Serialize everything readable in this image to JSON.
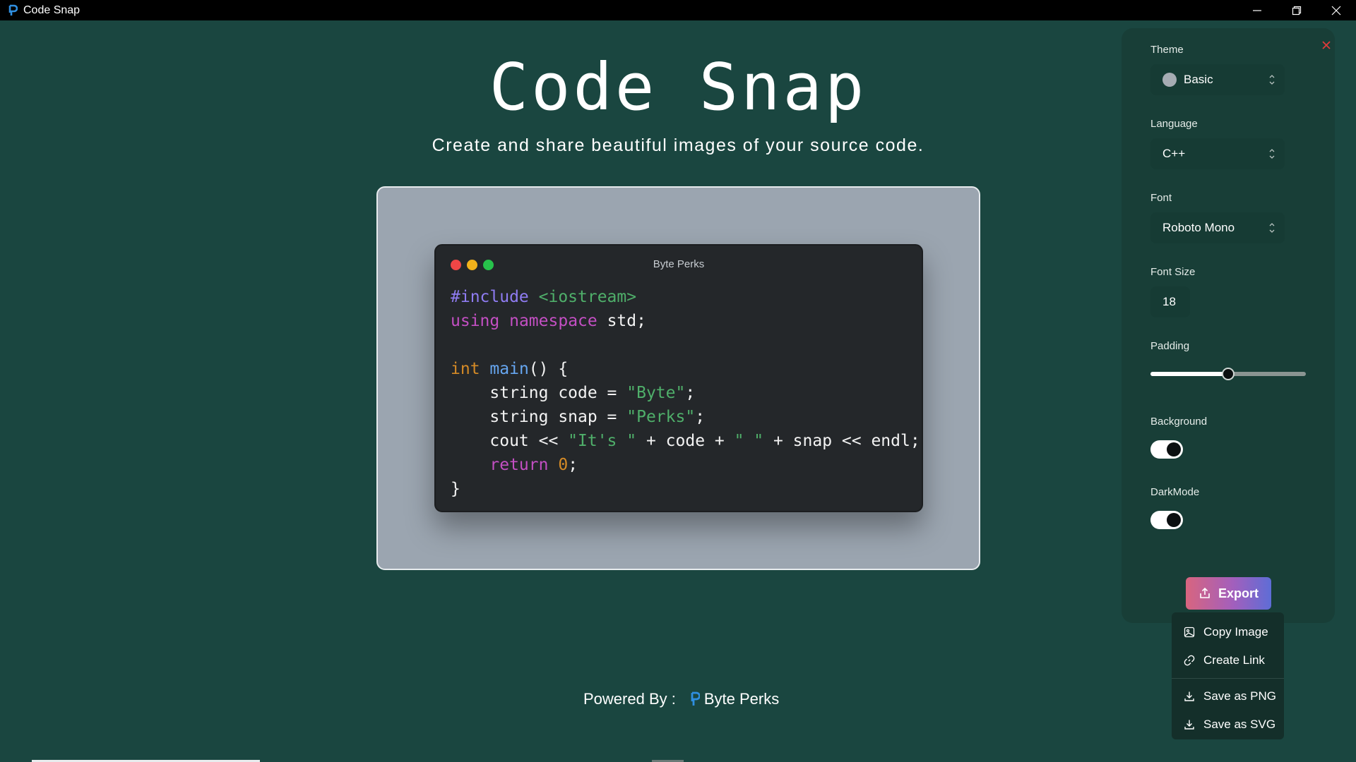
{
  "window": {
    "title": "Code Snap",
    "controls": [
      "minimize-icon",
      "restore-icon",
      "close-icon"
    ]
  },
  "header": {
    "title": "Code Snap",
    "subtitle": "Create and share beautiful images of your source code."
  },
  "code_window": {
    "title": "Byte Perks",
    "dots": [
      "#f04646",
      "#f2b21b",
      "#27c24b"
    ],
    "lines": [
      [
        {
          "t": "#include",
          "c": "pre"
        },
        {
          "t": " <iostream>",
          "c": "inc"
        }
      ],
      [
        {
          "t": "using",
          "c": "kw"
        },
        {
          "t": " ",
          "c": ""
        },
        {
          "t": "namespace",
          "c": "kw"
        },
        {
          "t": " std;",
          "c": ""
        }
      ],
      [
        {
          "t": "",
          "c": ""
        }
      ],
      [
        {
          "t": "int",
          "c": "type"
        },
        {
          "t": " ",
          "c": ""
        },
        {
          "t": "main",
          "c": "fn"
        },
        {
          "t": "() {",
          "c": ""
        }
      ],
      [
        {
          "t": "    string code = ",
          "c": ""
        },
        {
          "t": "\"Byte\"",
          "c": "str"
        },
        {
          "t": ";",
          "c": ""
        }
      ],
      [
        {
          "t": "    string snap = ",
          "c": ""
        },
        {
          "t": "\"Perks\"",
          "c": "str"
        },
        {
          "t": ";",
          "c": ""
        }
      ],
      [
        {
          "t": "    cout << ",
          "c": ""
        },
        {
          "t": "\"It's \"",
          "c": "str"
        },
        {
          "t": " + code + ",
          "c": ""
        },
        {
          "t": "\" \"",
          "c": "str"
        },
        {
          "t": " + snap << endl;",
          "c": ""
        }
      ],
      [
        {
          "t": "    ",
          "c": ""
        },
        {
          "t": "return",
          "c": "kw"
        },
        {
          "t": " ",
          "c": ""
        },
        {
          "t": "0",
          "c": "num"
        },
        {
          "t": ";",
          "c": ""
        }
      ],
      [
        {
          "t": "}",
          "c": ""
        }
      ]
    ]
  },
  "footer": {
    "label": "Powered By :",
    "brand": "Byte Perks"
  },
  "panel": {
    "theme": {
      "label": "Theme",
      "value": "Basic",
      "swatch": "#a6acb3"
    },
    "language": {
      "label": "Language",
      "value": "C++"
    },
    "font": {
      "label": "Font",
      "value": "Roboto Mono"
    },
    "font_size": {
      "label": "Font Size",
      "value": "18"
    },
    "padding": {
      "label": "Padding",
      "fraction": 0.5
    },
    "background": {
      "label": "Background",
      "on": true
    },
    "dark_mode": {
      "label": "DarkMode",
      "on": true
    },
    "export_label": "Export"
  },
  "export_menu": {
    "copy_image": "Copy Image",
    "create_link": "Create Link",
    "save_png": "Save as PNG",
    "save_svg": "Save as SVG"
  },
  "colors": {
    "background": "#1a4640",
    "panel": "#183e37",
    "stage": "#9ba5b0",
    "code_bg": "#24272a",
    "accent_close": "#e03a3a",
    "brand_icon": "#2f8fe0"
  }
}
